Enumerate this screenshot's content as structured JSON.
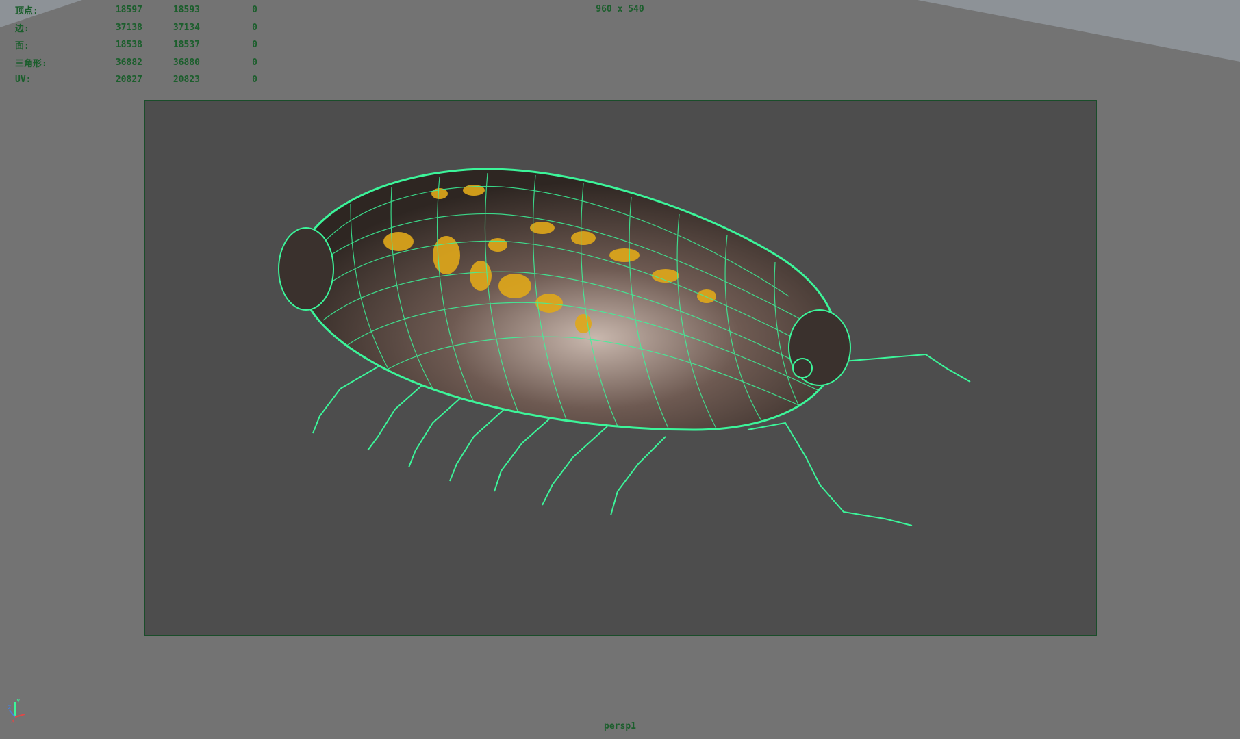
{
  "viewport": {
    "resolution_label": "960 x 540",
    "camera_name": "persp1"
  },
  "heads_up_display": {
    "rows": [
      {
        "label": "顶点:",
        "values": [
          "18597",
          "18593",
          "0"
        ]
      },
      {
        "label": "边:",
        "values": [
          "37138",
          "37134",
          "0"
        ]
      },
      {
        "label": "面:",
        "values": [
          "18538",
          "18537",
          "0"
        ]
      },
      {
        "label": "三角形:",
        "values": [
          "36882",
          "36880",
          "0"
        ]
      },
      {
        "label": "UV:",
        "values": [
          "20827",
          "20823",
          "0"
        ]
      }
    ]
  },
  "axis_gizmo": {
    "x": "x",
    "y": "y",
    "z": "z"
  },
  "colors": {
    "viewport_bg": "#737373",
    "gate_bg": "#4d4d4d",
    "hud_text": "#1b5e2c",
    "wireframe": "#3cf59a",
    "body_spots": "#e0a81a"
  },
  "model": {
    "description_icon": "isopod-wireframe-icon"
  }
}
